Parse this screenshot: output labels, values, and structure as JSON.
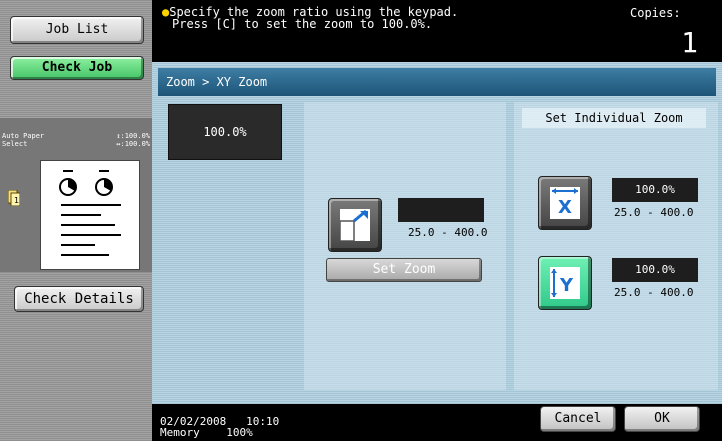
{
  "sidebar": {
    "job_list_label": "Job List",
    "check_job_label": "Check Job",
    "preview": {
      "row1_left": "Auto Paper",
      "row1_right": "↕:100.0%",
      "row2_left": "Select",
      "row2_right": "↔:100.0%"
    },
    "check_details_label": "Check Details"
  },
  "header": {
    "message_line1": "Specify the zoom ratio using the keypad.",
    "message_line2": "Press [C] to set the zoom to 100.0%.",
    "copies_label": "Copies:",
    "copies_value": "1"
  },
  "main": {
    "breadcrumb": "Zoom > XY Zoom",
    "zoom_display": "100.0%",
    "center": {
      "zoom_value": "",
      "range": "25.0  -  400.0",
      "set_zoom_label": "Set Zoom"
    },
    "right": {
      "title": "Set Individual Zoom",
      "x_value": "100.0%",
      "x_range": "25.0  -  400.0",
      "y_value": "100.0%",
      "y_range": "25.0  -  400.0"
    }
  },
  "footer": {
    "date": "02/02/2008",
    "time": "10:10",
    "memory_label": "Memory",
    "memory_value": "100%",
    "cancel_label": "Cancel",
    "ok_label": "OK"
  },
  "colors": {
    "title_bar": "#1d5578",
    "check_job": "#44c468",
    "active_zoom_button": "#2fc98a"
  },
  "icons": {
    "zoom_button": "diagonal-enlarge-icon",
    "x_zoom_button": "x-axis-zoom-icon",
    "y_zoom_button": "y-axis-zoom-icon",
    "message": "lightbulb-icon"
  }
}
